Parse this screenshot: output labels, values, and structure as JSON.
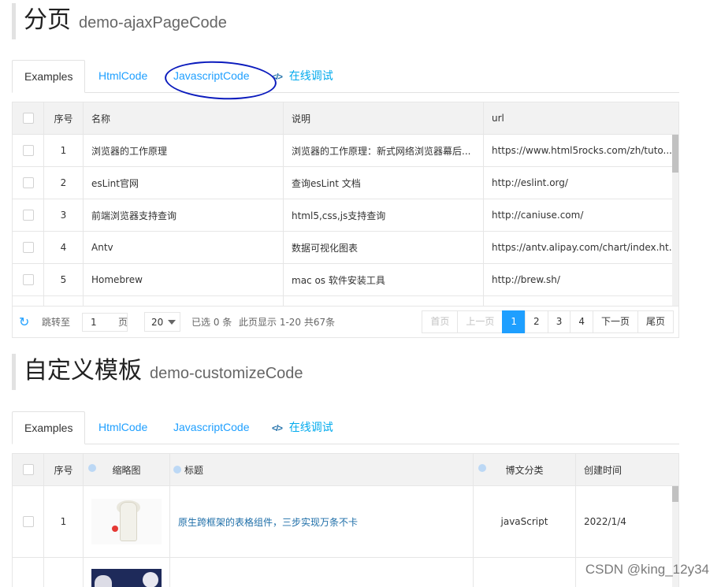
{
  "section1": {
    "title": "分页",
    "subtitle": "demo-ajaxPageCode",
    "tabs": [
      "Examples",
      "HtmlCode",
      "JavascriptCode",
      "在线调试"
    ],
    "online_icon": "code-debug-icon",
    "table": {
      "headers": [
        "序号",
        "名称",
        "说明",
        "url"
      ],
      "rows": [
        {
          "no": "1",
          "name": "浏览器的工作原理",
          "desc": "浏览器的工作原理：新式网络浏览器幕后...",
          "url": "https://www.html5rocks.com/zh/tuto..."
        },
        {
          "no": "2",
          "name": "esLint官网",
          "desc": "查询esLint 文档",
          "url": "http://eslint.org/"
        },
        {
          "no": "3",
          "name": "前端浏览器支持查询",
          "desc": "html5,css,js支持查询",
          "url": "http://caniuse.com/"
        },
        {
          "no": "4",
          "name": "Antv",
          "desc": "数据可视化图表",
          "url": "https://antv.alipay.com/chart/index.ht..."
        },
        {
          "no": "5",
          "name": "Homebrew",
          "desc": "mac os 软件安装工具",
          "url": "http://brew.sh/"
        }
      ]
    },
    "pager": {
      "jump_label": "跳转至",
      "jump_value": "1",
      "page_unit": "页",
      "page_size": "20",
      "selected": "已选 0 条",
      "summary": "此页显示 1-20 共67条",
      "buttons": {
        "first": "首页",
        "prev": "上一页",
        "p1": "1",
        "p2": "2",
        "p3": "3",
        "p4": "4",
        "next": "下一页",
        "last": "尾页"
      }
    }
  },
  "section2": {
    "title": "自定义模板",
    "subtitle": "demo-customizeCode",
    "tabs": [
      "Examples",
      "HtmlCode",
      "JavascriptCode",
      "在线调试"
    ],
    "table": {
      "headers": [
        "序号",
        "缩略图",
        "标题",
        "博文分类",
        "创建时间"
      ],
      "rows": [
        {
          "no": "1",
          "title": "原生跨框架的表格组件，三步实现万条不卡",
          "category": "javaScript",
          "date": "2022/1/4"
        }
      ]
    }
  },
  "watermark": "CSDN @king_12y34",
  "colors": {
    "accent": "#1e9fff",
    "link": "#01aaed",
    "annotation": "#0b1bbd"
  }
}
